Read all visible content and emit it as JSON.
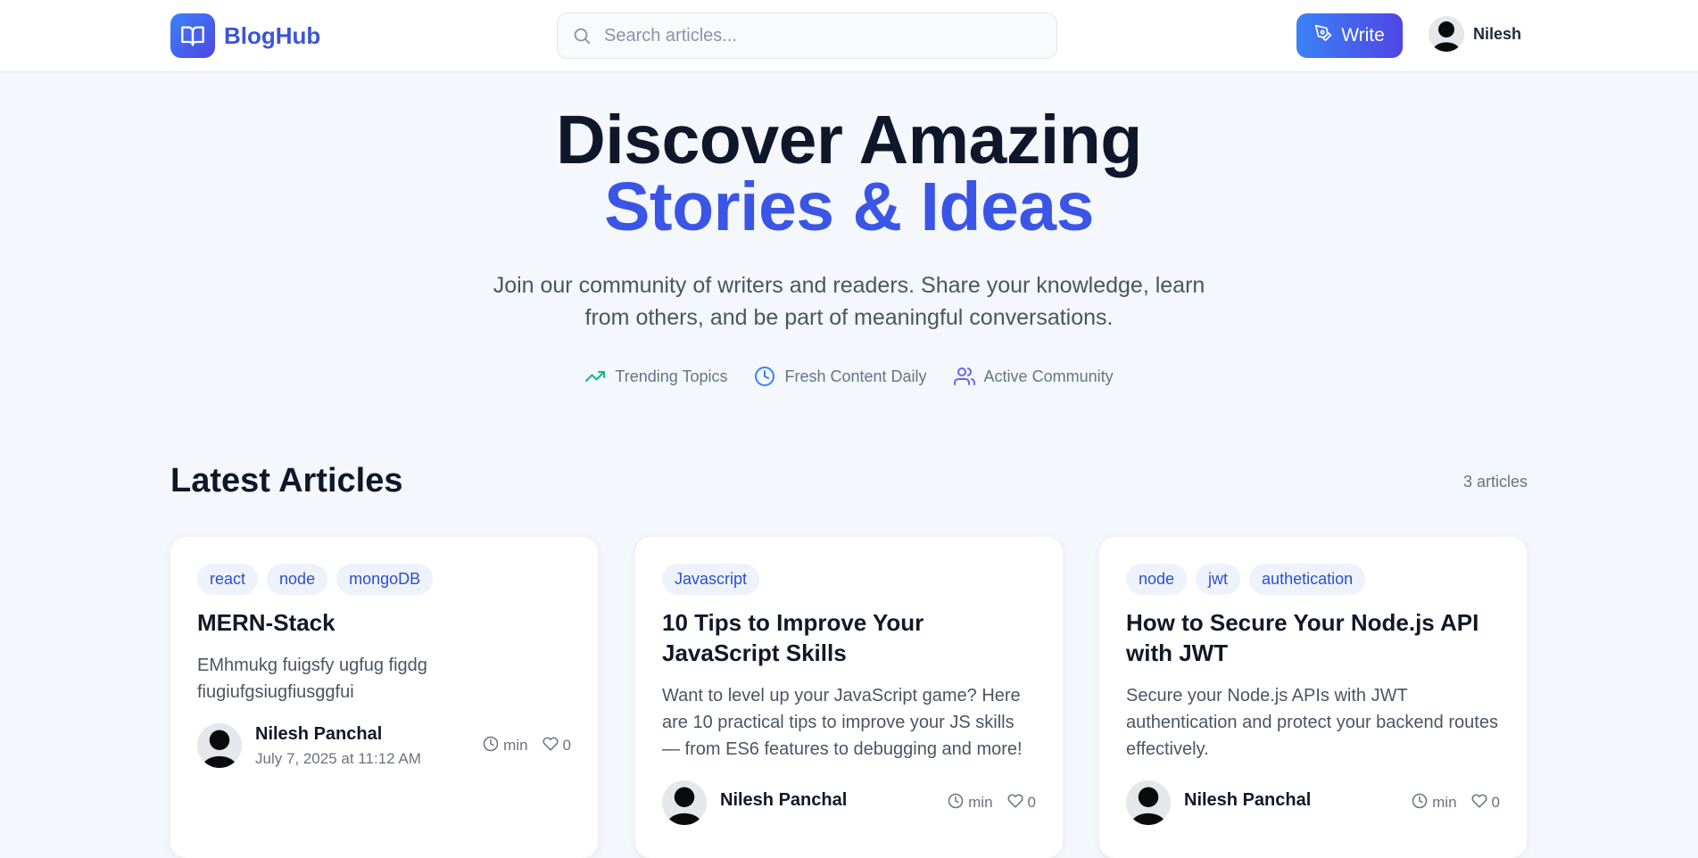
{
  "header": {
    "brand": "BlogHub",
    "search_placeholder": "Search articles...",
    "write_label": "Write",
    "user_name": "Nilesh"
  },
  "hero": {
    "title_line1": "Discover Amazing",
    "title_line2": "Stories & Ideas",
    "subtitle": "Join our community of writers and readers. Share your knowledge, learn from others, and be part of meaningful conversations.",
    "features": [
      {
        "label": "Trending Topics",
        "icon": "trending-up-icon"
      },
      {
        "label": "Fresh Content Daily",
        "icon": "clock-icon"
      },
      {
        "label": "Active Community",
        "icon": "users-icon"
      }
    ]
  },
  "section": {
    "title": "Latest Articles",
    "count": "3 articles"
  },
  "articles": [
    {
      "tags": [
        "react",
        "node",
        "mongoDB"
      ],
      "title": "MERN-Stack",
      "excerpt": "EMhmukg fuigsfy ugfug figdg fiugiufgsiugfiusggfui",
      "author": "Nilesh Panchal",
      "date": "July 7, 2025 at 11:12 AM",
      "read_time": "min",
      "likes": "0"
    },
    {
      "tags": [
        "Javascript"
      ],
      "title": "10 Tips to Improve Your JavaScript Skills",
      "excerpt": "Want to level up your JavaScript game? Here are 10 practical tips to improve your JS skills — from ES6 features to debugging and more!",
      "author": "Nilesh Panchal",
      "date": "",
      "read_time": "min",
      "likes": "0"
    },
    {
      "tags": [
        "node",
        "jwt",
        "authetication"
      ],
      "title": "How to Secure Your Node.js API with JWT",
      "excerpt": "Secure your Node.js APIs with JWT authentication and protect your backend routes effectively.",
      "author": "Nilesh Panchal",
      "date": "",
      "read_time": "min",
      "likes": "0"
    }
  ],
  "colors": {
    "accent": "#3b55e6",
    "tag_bg": "#eef2fb",
    "trending_icon": "#10b981",
    "clock_icon": "#3b82f6",
    "users_icon": "#6366f1"
  }
}
